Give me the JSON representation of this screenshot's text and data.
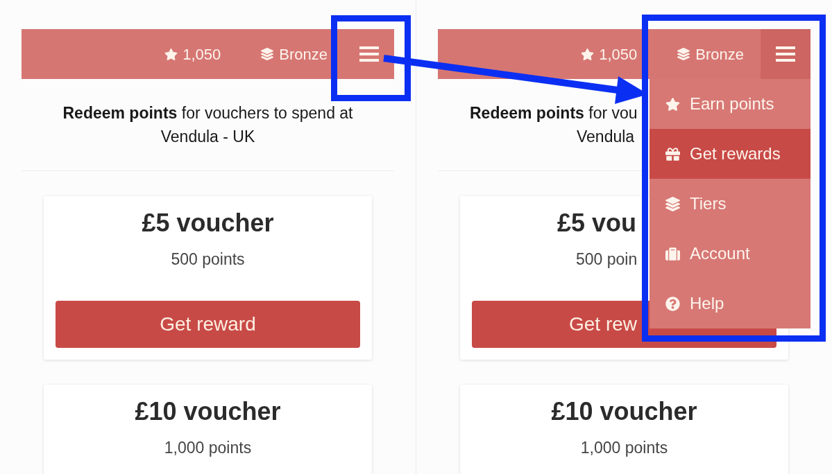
{
  "panels": [
    {
      "top_bar": {
        "points": "1,050",
        "tier": "Bronze",
        "menu_button": {
          "expanded": false
        }
      },
      "intro": [
        "**Redeem points** for vouchers to spend at Vendula - UK"
      ],
      "vouchers": [
        {
          "title": "£5 voucher",
          "points": "500 points",
          "button": "Get reward"
        },
        {
          "title": "£10 voucher",
          "points": "1,000 points"
        }
      ]
    },
    {
      "top_bar": {
        "points": "1,050",
        "tier": "Bronze",
        "menu_button": {
          "expanded": true
        }
      },
      "menu": [
        {
          "label": "Earn points",
          "selected": false
        },
        {
          "label": "Get rewards",
          "selected": true
        },
        {
          "label": "Tiers",
          "selected": false
        },
        {
          "label": "Account",
          "selected": false
        },
        {
          "label": "Help",
          "selected": false
        }
      ],
      "intro": [
        "**Redeem points** for vou",
        "Vendula"
      ],
      "vouchers": [
        {
          "title": "£5 vou",
          "points": "500 poin",
          "button": "Get rew"
        },
        {
          "title": "£10 voucher",
          "points": "1,000 points"
        }
      ]
    }
  ]
}
